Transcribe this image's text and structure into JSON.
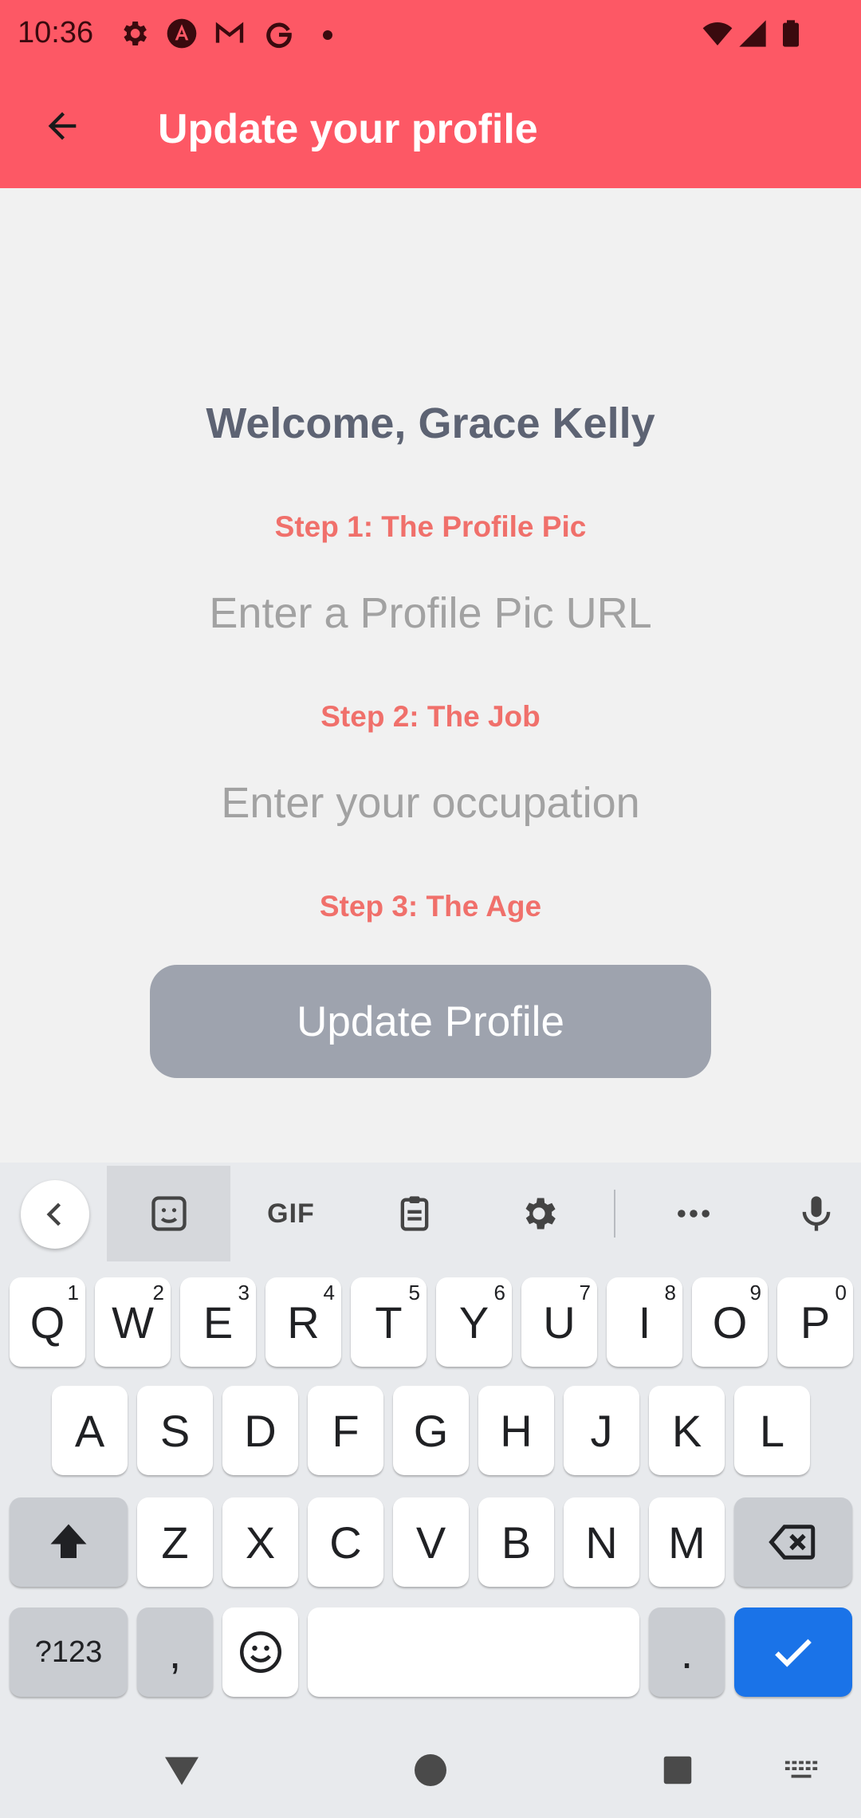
{
  "status_bar": {
    "time": "10:36",
    "icons": [
      "settings-icon",
      "angular-icon",
      "gmail-icon",
      "google-icon",
      "more-dot-icon",
      "wifi-icon",
      "signal-icon",
      "battery-icon"
    ]
  },
  "app_bar": {
    "title": "Update your profile",
    "back_icon": "arrow-back-icon",
    "color": "#fd5865"
  },
  "main": {
    "welcome": "Welcome, Grace Kelly",
    "step1_label": "Step 1: The Profile Pic",
    "step1_placeholder": "Enter a Profile Pic URL",
    "step1_value": "",
    "step2_label": "Step 2: The Job",
    "step2_placeholder": "Enter your occupation",
    "step2_value": "",
    "step3_label": "Step 3: The Age",
    "update_button": "Update Profile"
  },
  "keyboard": {
    "toolbar": {
      "items": [
        "chevron-left-icon",
        "sticker-icon",
        "GIF",
        "clipboard-icon",
        "gear-icon",
        "more-horiz-icon",
        "mic-icon"
      ],
      "gif_label": "GIF"
    },
    "row1": [
      {
        "key": "Q",
        "hint": "1"
      },
      {
        "key": "W",
        "hint": "2"
      },
      {
        "key": "E",
        "hint": "3"
      },
      {
        "key": "R",
        "hint": "4"
      },
      {
        "key": "T",
        "hint": "5"
      },
      {
        "key": "Y",
        "hint": "6"
      },
      {
        "key": "U",
        "hint": "7"
      },
      {
        "key": "I",
        "hint": "8"
      },
      {
        "key": "O",
        "hint": "9"
      },
      {
        "key": "P",
        "hint": "0"
      }
    ],
    "row2": [
      "A",
      "S",
      "D",
      "F",
      "G",
      "H",
      "J",
      "K",
      "L"
    ],
    "row3": [
      "Z",
      "X",
      "C",
      "V",
      "B",
      "N",
      "M"
    ],
    "row4": {
      "symbols": "?123",
      "comma": ",",
      "period": ".",
      "space": ""
    },
    "accent": "#1a73e8"
  },
  "nav_bar": {
    "icons": [
      "back-triangle-icon",
      "home-circle-icon",
      "recents-square-icon",
      "keyboard-switch-icon"
    ]
  }
}
